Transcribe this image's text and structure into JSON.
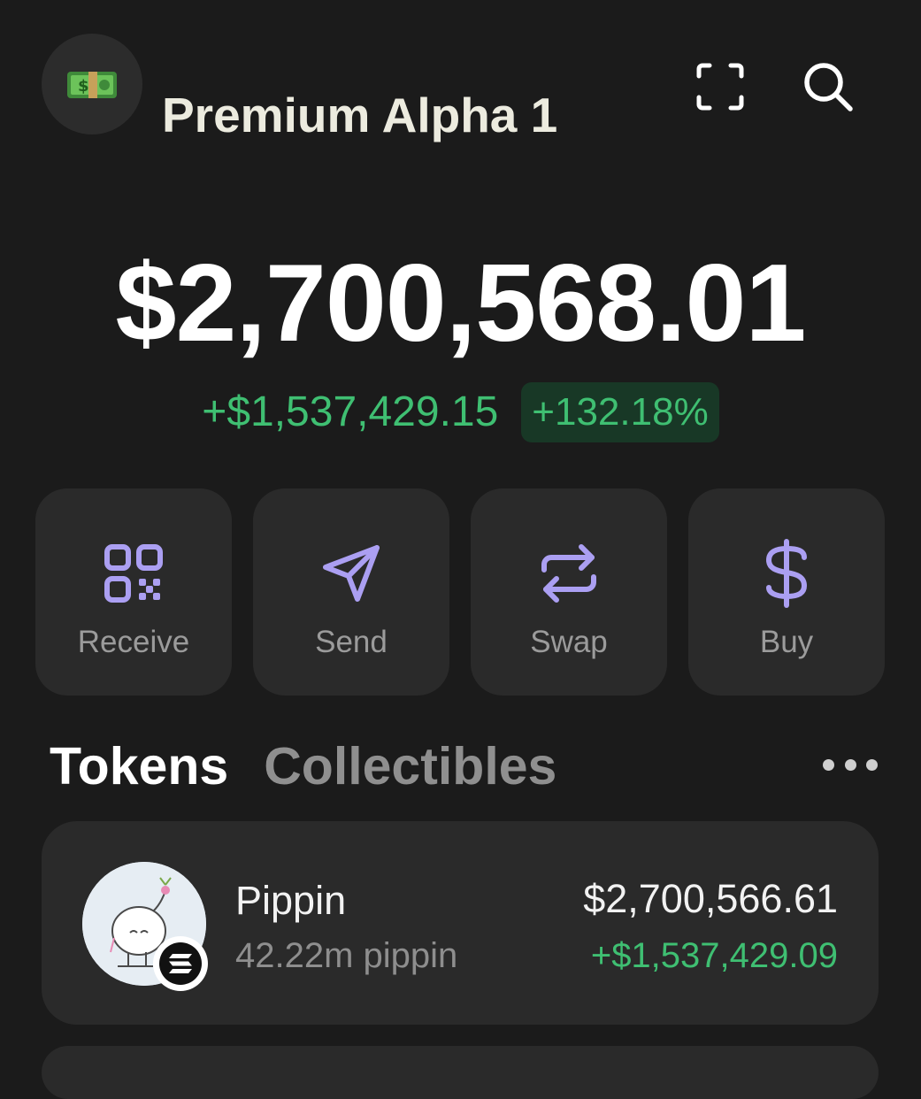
{
  "header": {
    "avatar_icon": "money-bill-emoji-icon",
    "account_name": "Premium Alpha 1",
    "scan_icon": "scan-icon",
    "search_icon": "search-icon"
  },
  "balance": {
    "total": "$2,700,568.01",
    "change_amount": "+$1,537,429.15",
    "change_percent": "+132.18%"
  },
  "actions": [
    {
      "label": "Receive",
      "icon": "qr-code-icon"
    },
    {
      "label": "Send",
      "icon": "send-icon"
    },
    {
      "label": "Swap",
      "icon": "swap-icon"
    },
    {
      "label": "Buy",
      "icon": "dollar-icon"
    }
  ],
  "tabs": [
    {
      "label": "Tokens",
      "active": true
    },
    {
      "label": "Collectibles",
      "active": false
    }
  ],
  "more_icon": "more-horizontal-icon",
  "tokens": [
    {
      "name": "Pippin",
      "amount": "42.22m pippin",
      "value": "$2,700,566.61",
      "change": "+$1,537,429.09",
      "chain_icon": "solana-icon"
    }
  ],
  "colors": {
    "background": "#1b1b1b",
    "card": "#2a2a2a",
    "accent": "#ab9ff2",
    "positive": "#3fbf72",
    "positive_bg": "#183826",
    "title": "#ecebdf"
  }
}
